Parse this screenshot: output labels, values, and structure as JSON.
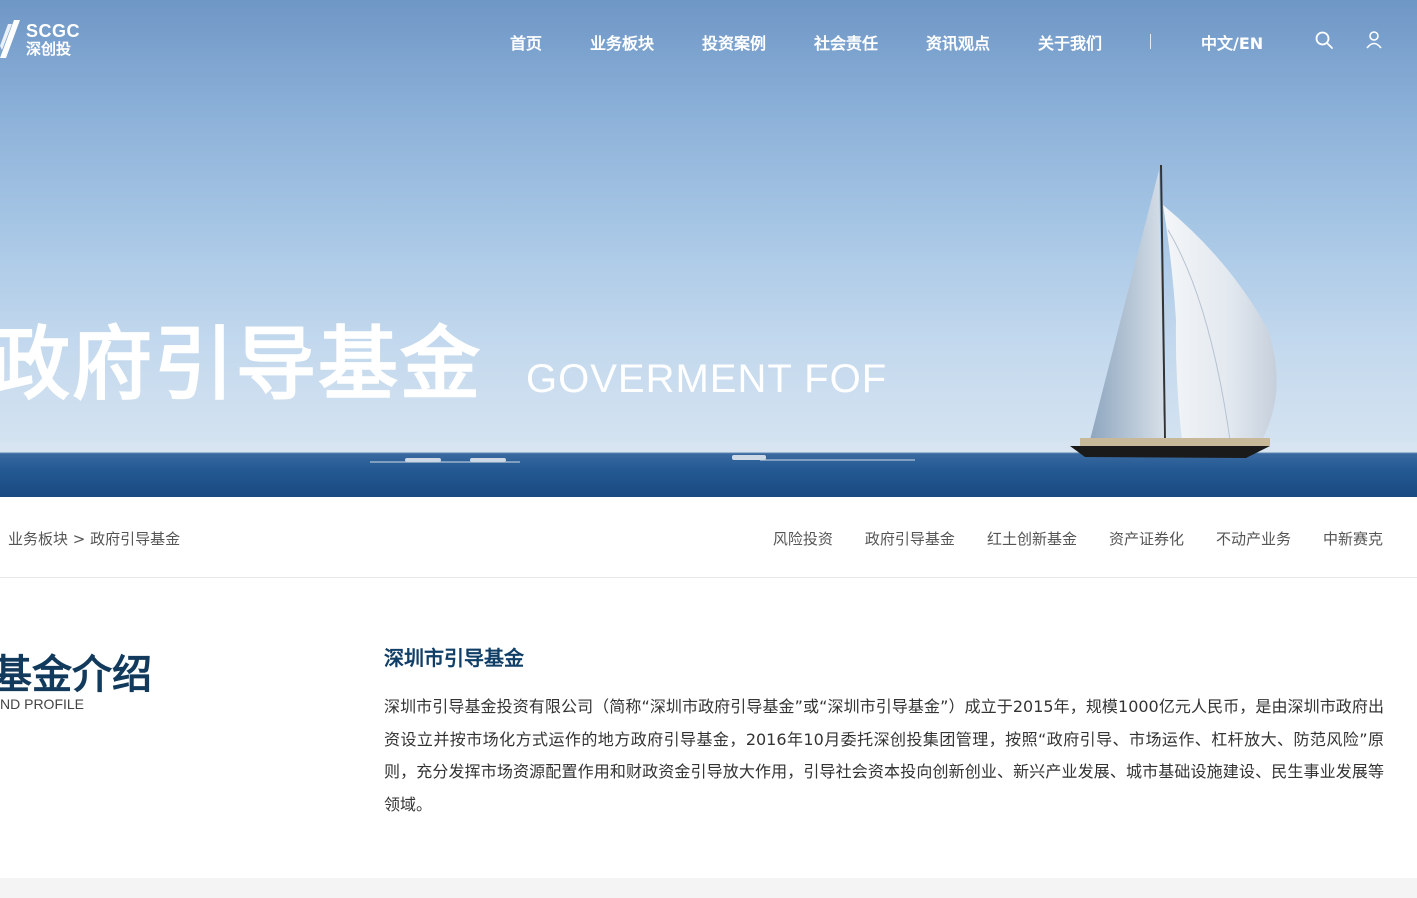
{
  "header": {
    "logo_en": "SCGC",
    "logo_cn": "深创投",
    "nav": [
      "首页",
      "业务板块",
      "投资案例",
      "社会责任",
      "资讯观点",
      "关于我们"
    ],
    "language": "中文/EN",
    "search_icon": "search-icon",
    "user_icon": "user-icon"
  },
  "hero": {
    "title_cn": "政府引导基金",
    "title_en": "GOVERMENT FOF"
  },
  "subnav": {
    "breadcrumb_parent": "业务板块",
    "breadcrumb_sep": ">",
    "breadcrumb_current": "政府引导基金",
    "tabs": [
      "风险投资",
      "政府引导基金",
      "红土创新基金",
      "资产证券化",
      "不动产业务",
      "中新赛克"
    ]
  },
  "content": {
    "section_title": "基金介绍",
    "section_subtitle": "ND PROFILE",
    "fund_title": "深圳市引导基金",
    "fund_body": "深圳市引导基金投资有限公司（简称“深圳市政府引导基金”或“深圳市引导基金”）成立于2015年，规模1000亿元人民币，是由深圳市政府出资设立并按市场化方式运作的地方政府引导基金，2016年10月委托深创投集团管理，按照“政府引导、市场运作、杠杆放大、防范风险”原则，充分发挥市场资源配置作用和财政资金引导放大作用，引导社会资本投向创新创业、新兴产业发展、城市基础设施建设、民生事业发展等领域。"
  },
  "colors": {
    "brand_dark": "#123a5c",
    "fund_title": "#0f3e67",
    "sky_top": "#6f97c6",
    "sea": "#1e4f86"
  }
}
